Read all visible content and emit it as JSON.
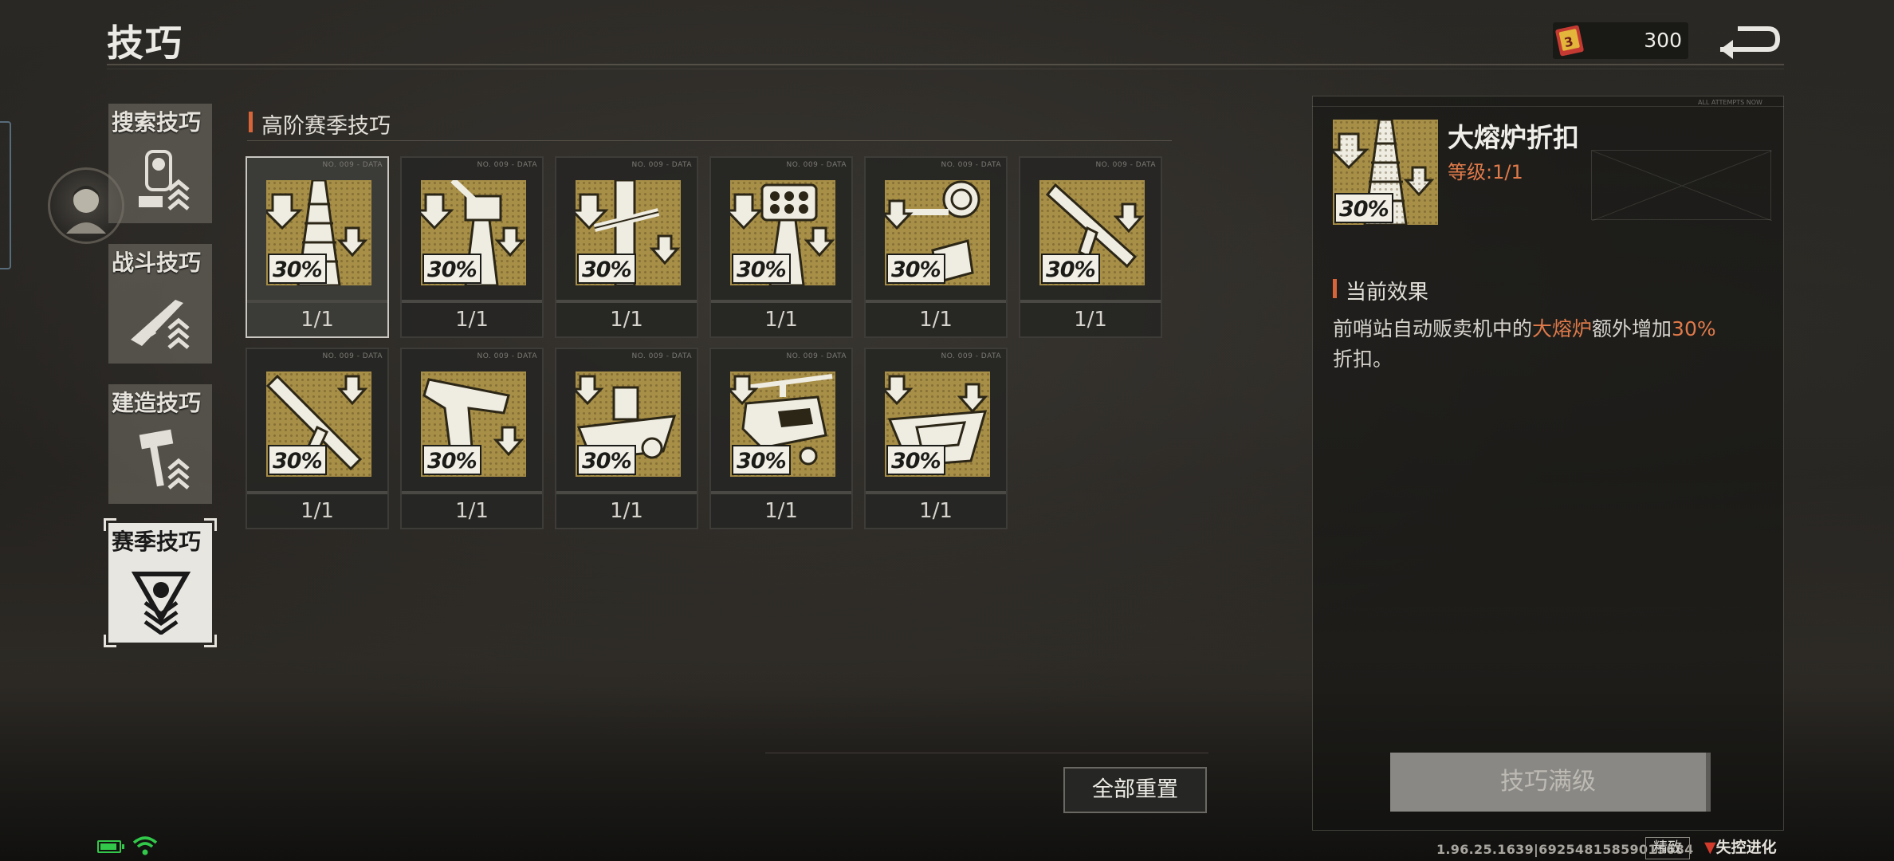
{
  "header": {
    "title": "技巧",
    "currency_value": "300",
    "currency_icon": "skill-book-icon",
    "back_icon": "return-arrow-icon"
  },
  "sidebar": {
    "items": [
      {
        "label": "搜索技巧",
        "icon": "search-skill-icon",
        "active": false
      },
      {
        "label": "战斗技巧",
        "icon": "rifle-icon",
        "active": false
      },
      {
        "label": "建造技巧",
        "icon": "hammer-icon",
        "active": false
      },
      {
        "label": "赛季技巧",
        "icon": "season-emblem-icon",
        "active": true
      }
    ]
  },
  "section": {
    "title": "高阶赛季技巧"
  },
  "skills": [
    {
      "tag": "NO. 009 - DATA",
      "discount": "30%",
      "level": "1/1",
      "icon": "furnace-tower-icon",
      "selected": true
    },
    {
      "tag": "NO. 009 - DATA",
      "discount": "30%",
      "level": "1/1",
      "icon": "turret-icon",
      "selected": false
    },
    {
      "tag": "NO. 009 - DATA",
      "discount": "30%",
      "level": "1/1",
      "icon": "pipe-wrench-icon",
      "selected": false
    },
    {
      "tag": "NO. 009 - DATA",
      "discount": "30%",
      "level": "1/1",
      "icon": "rocket-launcher-icon",
      "selected": false
    },
    {
      "tag": "NO. 009 - DATA",
      "discount": "30%",
      "level": "1/1",
      "icon": "searchlight-icon",
      "selected": false
    },
    {
      "tag": "NO. 009 - DATA",
      "discount": "30%",
      "level": "1/1",
      "icon": "machine-gun-icon",
      "selected": false
    },
    {
      "tag": "NO. 009 - DATA",
      "discount": "30%",
      "level": "1/1",
      "icon": "assault-rifle-icon",
      "selected": false
    },
    {
      "tag": "NO. 009 - DATA",
      "discount": "30%",
      "level": "1/1",
      "icon": "pistol-icon",
      "selected": false
    },
    {
      "tag": "NO. 009 - DATA",
      "discount": "30%",
      "level": "1/1",
      "icon": "boat-icon",
      "selected": false
    },
    {
      "tag": "NO. 009 - DATA",
      "discount": "30%",
      "level": "1/1",
      "icon": "helicopter-icon",
      "selected": false
    },
    {
      "tag": "NO. 009 - DATA",
      "discount": "30%",
      "level": "1/1",
      "icon": "speedboat-icon",
      "selected": false
    }
  ],
  "details": {
    "panel_tag": "ALL ATTEMPTS NOW",
    "name": "大熔炉折扣",
    "discount": "30%",
    "level": "等级:1/1",
    "effect_title": "当前效果",
    "effect_prefix": "前哨站自动贩卖机中的",
    "effect_highlight": "大熔炉",
    "effect_middle": "额外增加",
    "effect_value": "30%",
    "effect_suffix": "折扣。",
    "max_button": "技巧满级"
  },
  "actions": {
    "reset_all": "全部重置"
  },
  "footer": {
    "version": "1.96.25.1639|69254815859015684",
    "quality": "精致",
    "game_logo": "失控进化"
  },
  "colors": {
    "accent": "#d8643a",
    "highlight": "#e07a4a",
    "skill_gold": "#a88f48",
    "battery_green": "#32c84a"
  }
}
